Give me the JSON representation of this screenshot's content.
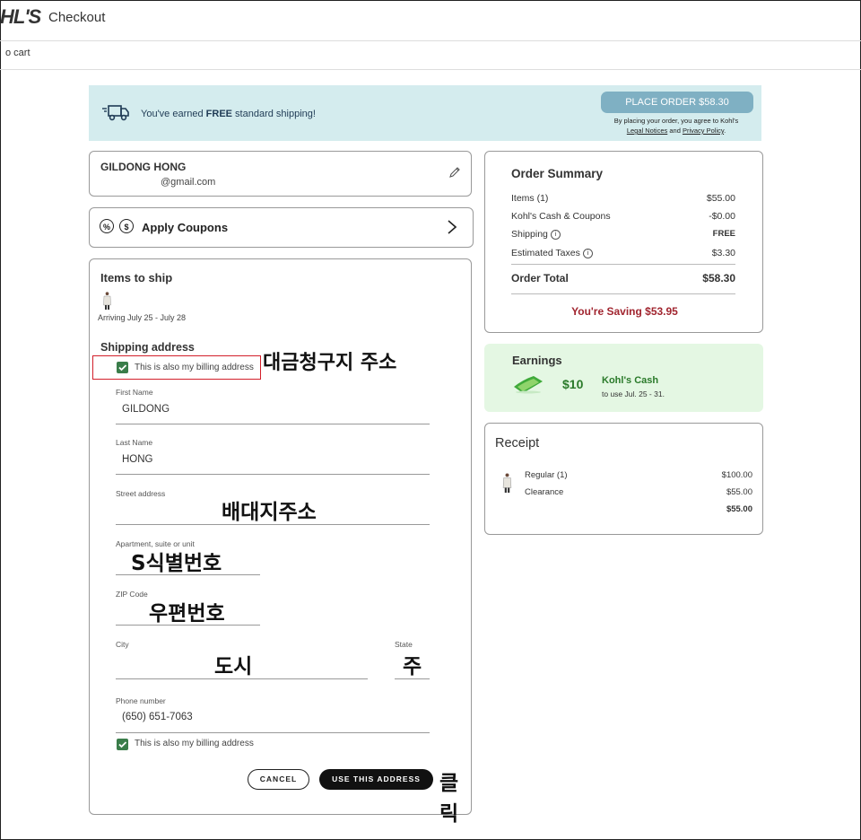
{
  "header": {
    "logo": "HL'S",
    "title": "Checkout",
    "back_link": "o cart"
  },
  "banner": {
    "message_prefix": "You've earned ",
    "message_bold": "FREE",
    "message_suffix": " standard shipping!",
    "place_order_label": "PLACE ORDER $58.30",
    "terms_line1": "By placing your order, you agree to Kohl's",
    "terms_legal": "Legal Notices",
    "terms_and": " and ",
    "terms_privacy": "Privacy Policy",
    "terms_end": ".",
    "icon": "truck-icon"
  },
  "user": {
    "name": "GILDONG HONG",
    "email": "@gmail.com",
    "edit_icon": "pencil-icon"
  },
  "coupons": {
    "icon1": "%",
    "icon2": "$",
    "label": "Apply Coupons"
  },
  "shipping": {
    "items_title": "Items to ship",
    "arriving": "Arriving July 25 - July 28",
    "address_title": "Shipping address",
    "billing_checkbox_top": "This is also my billing address",
    "first_name": {
      "label": "First Name",
      "value": "GILDONG"
    },
    "last_name": {
      "label": "Last Name",
      "value": "HONG"
    },
    "street": {
      "label": "Street address",
      "value": ""
    },
    "apartment": {
      "label": "Apartment, suite or unit",
      "value": ""
    },
    "zip": {
      "label": "ZIP Code",
      "value": ""
    },
    "city": {
      "label": "City",
      "value": ""
    },
    "state": {
      "label": "State",
      "value": ""
    },
    "phone": {
      "label": "Phone number",
      "value": "(650) 651-7063"
    },
    "billing_checkbox_bottom": "This is also my billing address",
    "cancel_label": "CANCEL",
    "use_address_label": "USE THIS ADDRESS"
  },
  "annotations": {
    "billing": "대금청구지 주소",
    "street": "배대지주소",
    "apartment": "S식별번호",
    "zip": "우편번호",
    "city": "도시",
    "state": "주",
    "click": "클릭"
  },
  "summary": {
    "title": "Order Summary",
    "rows": [
      {
        "label": "Items (1)",
        "value": "$55.00"
      },
      {
        "label": "Kohl's Cash & Coupons",
        "value": "-$0.00"
      },
      {
        "label": "Shipping",
        "value": "FREE"
      },
      {
        "label": "Estimated Taxes",
        "value": "$3.30"
      }
    ],
    "info_glyph": "i",
    "total_label": "Order Total",
    "total_value": "$58.30",
    "saving": "You're Saving $53.95"
  },
  "earnings": {
    "title": "Earnings",
    "amount": "$10",
    "name": "Kohl's Cash",
    "sub": "to use Jul. 25 - 31."
  },
  "receipt": {
    "title": "Receipt",
    "rows": [
      {
        "label": "Regular (1)",
        "value": "$100.00"
      },
      {
        "label": "Clearance",
        "value": "$55.00"
      },
      {
        "label": "",
        "value": "$55.00"
      }
    ]
  },
  "colors": {
    "banner_bg": "#d4ecee",
    "place_order": "#7fb0c3",
    "checkbox": "#3a7d4a",
    "saving": "#a1252f",
    "earn_bg": "#e4f7e3",
    "earn_green": "#2a7a2a",
    "highlight": "#d21f2a"
  }
}
